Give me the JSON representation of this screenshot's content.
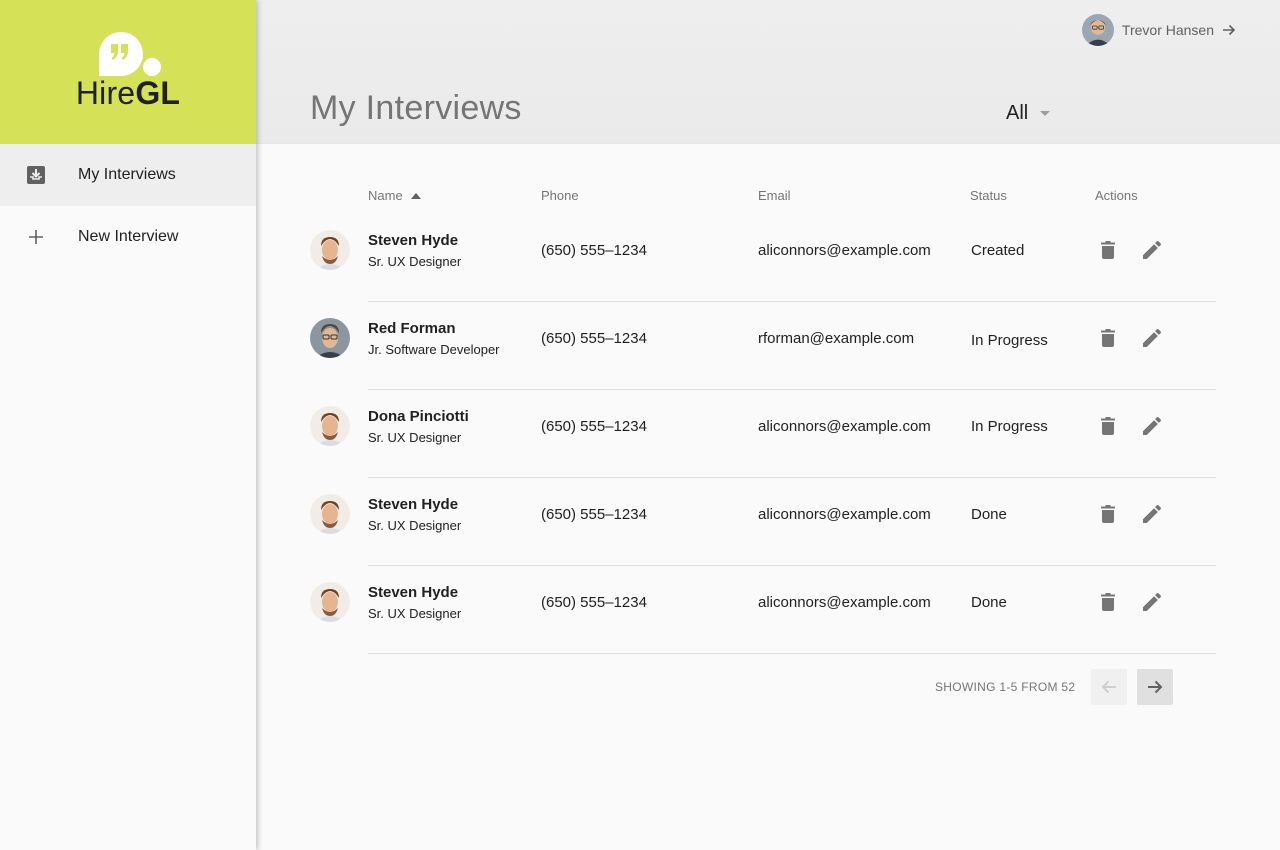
{
  "brand": {
    "name_part1": "Hire",
    "name_part2": "GL",
    "quote_glyph": "❞",
    "accent_color": "#d5e157"
  },
  "sidebar": {
    "items": [
      {
        "label": "My Interviews",
        "icon": "inbox-download-icon",
        "active": true
      },
      {
        "label": "New Interview",
        "icon": "plus-icon",
        "active": false
      }
    ]
  },
  "header": {
    "user_name": "Trevor Hansen",
    "title": "My Interviews",
    "filter_value": "All"
  },
  "table": {
    "columns": {
      "name": "Name",
      "phone": "Phone",
      "email": "Email",
      "status": "Status",
      "actions": "Actions"
    },
    "sort": {
      "column": "Name",
      "direction": "ascending"
    },
    "rows": [
      {
        "name": "Steven Hyde",
        "title": "Sr. UX Designer",
        "phone": "(650) 555–1234",
        "email": "aliconnors@example.com",
        "status": "Created"
      },
      {
        "name": "Red Forman",
        "title": "Jr. Software Developer",
        "phone": "(650) 555–1234",
        "email": "rforman@example.com",
        "status": "In Progress"
      },
      {
        "name": "Dona Pinciotti",
        "title": "Sr. UX Designer",
        "phone": "(650) 555–1234",
        "email": "aliconnors@example.com",
        "status": "In Progress"
      },
      {
        "name": "Steven Hyde",
        "title": "Sr. UX Designer",
        "phone": "(650) 555–1234",
        "email": "aliconnors@example.com",
        "status": "Done"
      },
      {
        "name": "Steven Hyde",
        "title": "Sr. UX Designer",
        "phone": "(650) 555–1234",
        "email": "aliconnors@example.com",
        "status": "Done"
      }
    ]
  },
  "pagination": {
    "text": "SHOWING 1-5 FROM 52",
    "prev_enabled": false,
    "next_enabled": true
  },
  "colors": {
    "sidebar_brand_bg": "#d5e157",
    "header_bg": "#eeeeee",
    "active_nav_bg": "#eeeeee",
    "icon_gray": "#757575"
  }
}
